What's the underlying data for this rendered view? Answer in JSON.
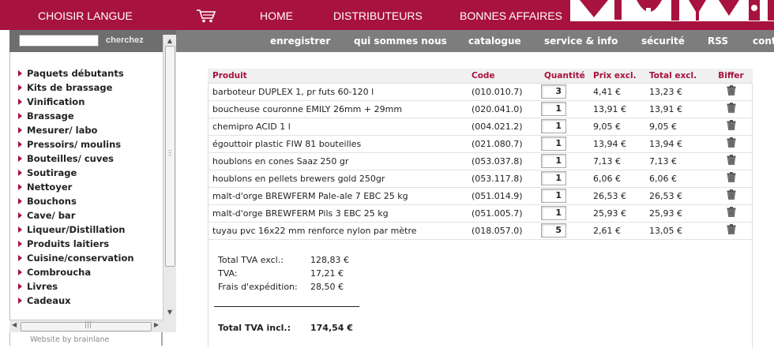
{
  "topnav": {
    "lang": "CHOISIR LANGUE",
    "home": "HOME",
    "distributeurs": "DISTRIBUTEURS",
    "bonnes_affaires": "BONNES AFFAIRES"
  },
  "search": {
    "placeholder": "",
    "button": "cherchez"
  },
  "subnav": [
    "enregistrer",
    "qui sommes nous",
    "catalogue",
    "service & info",
    "sécurité",
    "RSS",
    "cont"
  ],
  "categories": [
    "Paquets débutants",
    "Kits de brassage",
    "Vinification",
    "Brassage",
    "Mesurer/ labo",
    "Pressoirs/ moulins",
    "Bouteilles/ cuves",
    "Soutirage",
    "Nettoyer",
    "Bouchons",
    "Cave/ bar",
    "Liqueur/Distillation",
    "Produits laitiers",
    "Cuisine/conservation",
    "Combroucha",
    "Livres",
    "Cadeaux"
  ],
  "credit": "Website by brainlane",
  "table": {
    "headers": {
      "produit": "Produit",
      "code": "Code",
      "quantite": "Quantité",
      "prix": "Prix excl.",
      "total": "Total excl.",
      "biffer": "Biffer"
    },
    "rows": [
      {
        "produit": "barboteur DUPLEX 1, pr futs 60-120 l",
        "code": "(010.010.7)",
        "qty": "3",
        "prix": "4,41 €",
        "total": "13,23 €"
      },
      {
        "produit": "boucheuse couronne EMILY 26mm + 29mm",
        "code": "(020.041.0)",
        "qty": "1",
        "prix": "13,91 €",
        "total": "13,91 €"
      },
      {
        "produit": "chemipro ACID 1 l",
        "code": "(004.021.2)",
        "qty": "1",
        "prix": "9,05 €",
        "total": "9,05 €"
      },
      {
        "produit": "égouttoir plastic FIW 81 bouteilles",
        "code": "(021.080.7)",
        "qty": "1",
        "prix": "13,94 €",
        "total": "13,94 €"
      },
      {
        "produit": "houblons en cones Saaz 250 gr",
        "code": "(053.037.8)",
        "qty": "1",
        "prix": "7,13 €",
        "total": "7,13 €"
      },
      {
        "produit": "houblons en pellets brewers gold 250gr",
        "code": "(053.117.8)",
        "qty": "1",
        "prix": "6,06 €",
        "total": "6,06 €"
      },
      {
        "produit": "malt-d'orge BREWFERM Pale-ale 7 EBC 25 kg",
        "code": "(051.014.9)",
        "qty": "1",
        "prix": "26,53 €",
        "total": "26,53 €"
      },
      {
        "produit": "malt-d'orge BREWFERM Pils 3 EBC 25 kg",
        "code": "(051.005.7)",
        "qty": "1",
        "prix": "25,93 €",
        "total": "25,93 €"
      },
      {
        "produit": "tuyau pvc 16x22 mm renforce nylon par mètre",
        "code": "(018.057.0)",
        "qty": "5",
        "prix": "2,61 €",
        "total": "13,05 €"
      }
    ]
  },
  "summary": {
    "total_excl_label": "Total TVA excl.:",
    "total_excl": "128,83 €",
    "tva_label": "TVA:",
    "tva": "17,21 €",
    "frais_label": "Frais d'expédition:",
    "frais": "28,50 €",
    "total_incl_label": "Total TVA incl.:",
    "total_incl": "174,54 €"
  },
  "colors": {
    "brand": "#a8123e",
    "subnav": "#7d7d7d"
  }
}
